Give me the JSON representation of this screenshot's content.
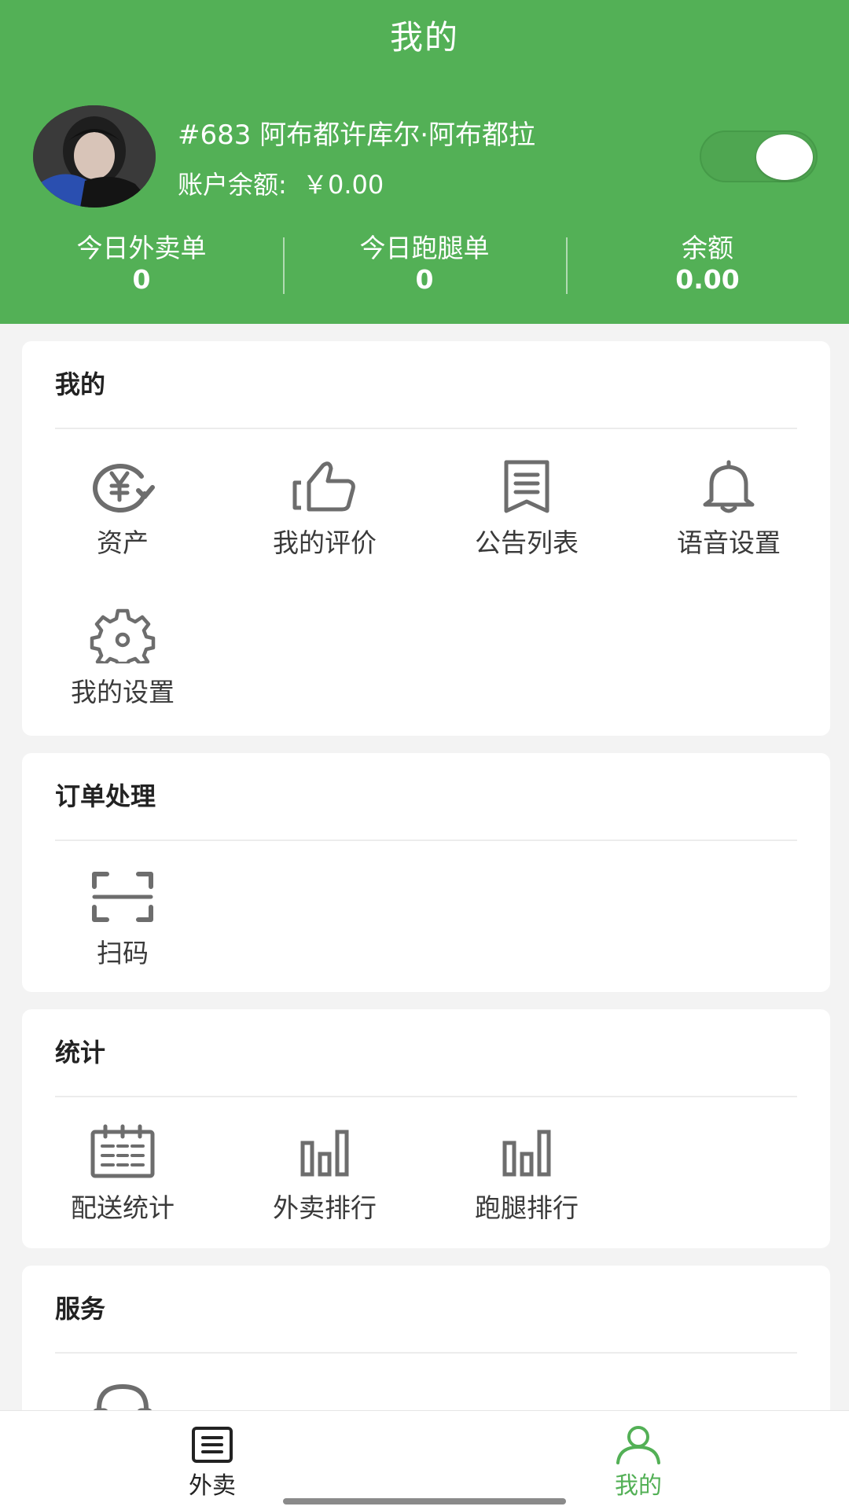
{
  "header": {
    "title": "我的",
    "profile": {
      "name": "#683 阿布都许库尔·阿布都拉",
      "balance_label": "账户余额:",
      "balance_value": "￥0.00",
      "toggle_on": true
    },
    "stats": [
      {
        "label": "今日外卖单",
        "value": "0"
      },
      {
        "label": "今日跑腿单",
        "value": "0"
      },
      {
        "label": "余额",
        "value": "0.00"
      }
    ]
  },
  "sections": {
    "mine": {
      "title": "我的",
      "items": [
        {
          "label": "资产",
          "icon": "asset-yen-icon"
        },
        {
          "label": "我的评价",
          "icon": "thumbs-up-icon"
        },
        {
          "label": "公告列表",
          "icon": "notice-list-icon"
        },
        {
          "label": "语音设置",
          "icon": "bell-icon"
        },
        {
          "label": "我的设置",
          "icon": "gear-icon"
        }
      ]
    },
    "orders": {
      "title": "订单处理",
      "items": [
        {
          "label": "扫码",
          "icon": "scan-icon"
        }
      ]
    },
    "stats": {
      "title": "统计",
      "items": [
        {
          "label": "配送统计",
          "icon": "calendar-icon"
        },
        {
          "label": "外卖排行",
          "icon": "bar-chart-icon"
        },
        {
          "label": "跑腿排行",
          "icon": "bar-chart-icon"
        }
      ]
    },
    "service": {
      "title": "服务",
      "items": [
        {
          "label": "",
          "icon": "headset-icon"
        }
      ]
    }
  },
  "tabbar": {
    "tabs": [
      {
        "label": "外卖",
        "icon": "list-doc-icon",
        "active": false
      },
      {
        "label": "我的",
        "icon": "user-icon",
        "active": true
      }
    ]
  },
  "colors": {
    "brand_green": "#53b056",
    "active_tab": "#53b056",
    "icon_gray": "#6d6d6d"
  }
}
